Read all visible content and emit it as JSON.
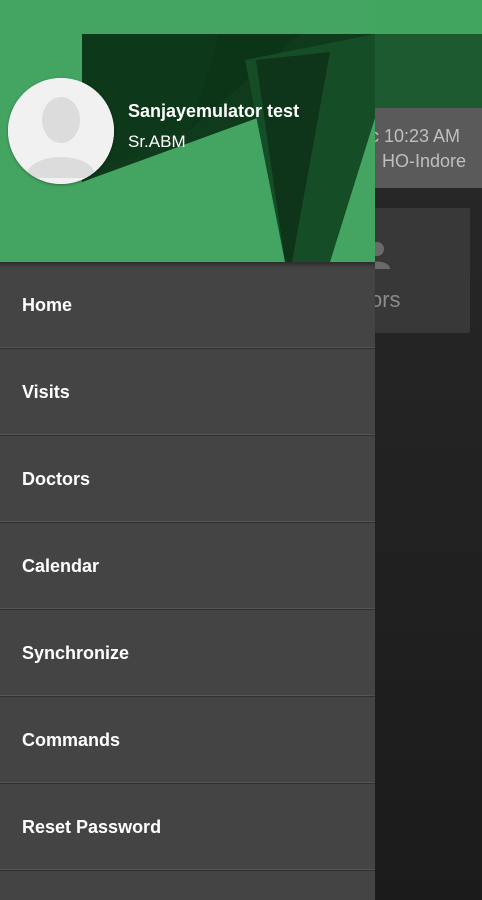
{
  "background_screen": {
    "time_text": "c 10:23 AM",
    "location_text": "HO-Indore",
    "tile_label": "ors",
    "tile_icon": "person-icon"
  },
  "drawer": {
    "user_name": "Sanjayemulator test",
    "user_role": "Sr.ABM",
    "avatar_icon": "default-avatar-icon",
    "menu": [
      {
        "label": "Home"
      },
      {
        "label": "Visits"
      },
      {
        "label": "Doctors"
      },
      {
        "label": "Calendar"
      },
      {
        "label": "Synchronize"
      },
      {
        "label": "Commands"
      },
      {
        "label": "Reset Password"
      }
    ]
  },
  "colors": {
    "status_bar": "#41a560",
    "header_green": "#44a563",
    "header_dark_green": "#123d1f",
    "drawer_bg": "#444444",
    "menu_text": "#ffffff"
  }
}
